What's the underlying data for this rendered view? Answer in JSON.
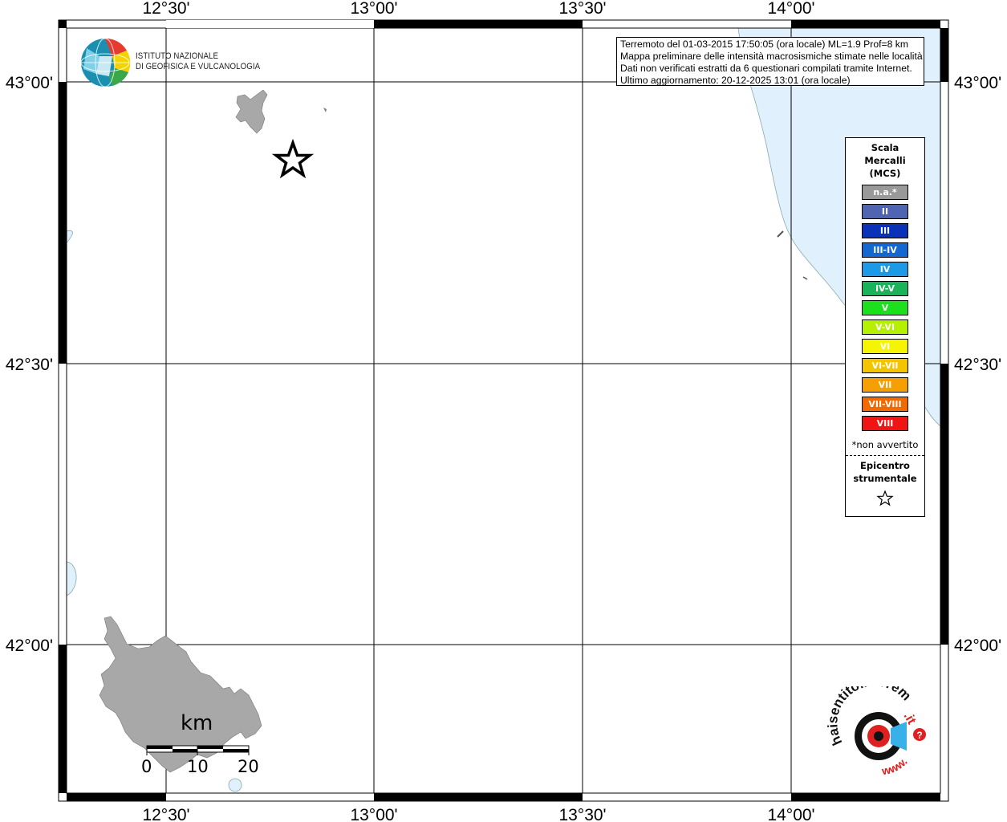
{
  "info": {
    "lines": [
      "Terremoto del 01-03-2015 17:50:05 (ora locale) ML=1.9 Prof=8 km",
      "Mappa preliminare delle intensità macrosismiche stimate nelle località",
      "Dati non verificati estratti da 6 questionari compilati tramite Internet.",
      "Ultimo aggiornamento: 20-12-2025 13:01 (ora locale)"
    ]
  },
  "axes": {
    "top": [
      "12°30'",
      "13°00'",
      "13°30'",
      "14°00'"
    ],
    "bottom": [
      "12°30'",
      "13°00'",
      "13°30'",
      "14°00'"
    ],
    "left": [
      "43°00'",
      "42°30'",
      "42°00'"
    ],
    "right": [
      "43°00'",
      "42°30'",
      "42°00'"
    ]
  },
  "logo": {
    "line1": "ISTITUTO NAZIONALE",
    "line2": "DI GEOFISICA E VULCANOLOGIA"
  },
  "legend": {
    "title": [
      "Scala",
      "Mercalli",
      "(MCS)"
    ],
    "items": [
      {
        "label": "n.a.*",
        "color": "#999999"
      },
      {
        "label": "II",
        "color": "#4f65b1"
      },
      {
        "label": "III",
        "color": "#0a32b8"
      },
      {
        "label": "III-IV",
        "color": "#1268d0"
      },
      {
        "label": "IV",
        "color": "#1d9ae6"
      },
      {
        "label": "IV-V",
        "color": "#19b35a"
      },
      {
        "label": "V",
        "color": "#1de01d"
      },
      {
        "label": "V-VI",
        "color": "#b4f000"
      },
      {
        "label": "VI",
        "color": "#f5f500"
      },
      {
        "label": "VI-VII",
        "color": "#f5c400"
      },
      {
        "label": "VII",
        "color": "#f5a000"
      },
      {
        "label": "VII-VIII",
        "color": "#f06a00"
      },
      {
        "label": "VIII",
        "color": "#f01414"
      }
    ],
    "note": "*non avvertito",
    "epicenter": [
      "Epicentro",
      "strumentale"
    ]
  },
  "scale": {
    "unit": "km",
    "ticks": [
      "0",
      "10",
      "20"
    ]
  },
  "hst": {
    "text_main": "haisentitoilterremoto",
    "text_it": ".it",
    "text_www": "www.",
    "text_q": "?"
  }
}
